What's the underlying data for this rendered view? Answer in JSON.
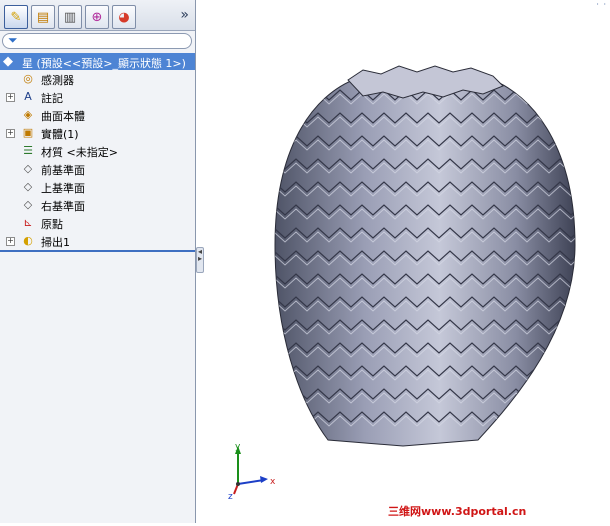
{
  "tabs": [
    {
      "name": "feature-manager",
      "icon": "feature-manager-icon"
    },
    {
      "name": "property-manager",
      "icon": "property-manager-icon"
    },
    {
      "name": "configuration-manager",
      "icon": "configuration-manager-icon"
    },
    {
      "name": "dimxpert-manager",
      "icon": "dimxpert-icon"
    },
    {
      "name": "display-manager",
      "icon": "display-manager-icon"
    }
  ],
  "expand_label": "»",
  "root": {
    "label": "星 (預設<<預設>_顯示狀態 1>)"
  },
  "tree": [
    {
      "label": "感測器",
      "icon": "sensor-icon",
      "expandable": false
    },
    {
      "label": "註記",
      "icon": "annotation-icon",
      "expandable": true
    },
    {
      "label": "曲面本體",
      "icon": "surface-body-icon",
      "expandable": false
    },
    {
      "label": "實體(1)",
      "icon": "solid-body-icon",
      "expandable": true
    },
    {
      "label": "材質 <未指定>",
      "icon": "material-icon",
      "expandable": false
    },
    {
      "label": "前基準面",
      "icon": "plane-icon",
      "expandable": false
    },
    {
      "label": "上基準面",
      "icon": "plane-icon",
      "expandable": false
    },
    {
      "label": "右基準面",
      "icon": "plane-icon",
      "expandable": false
    },
    {
      "label": "原點",
      "icon": "origin-icon",
      "expandable": false
    },
    {
      "label": "掃出1",
      "icon": "sweep-icon",
      "expandable": true
    }
  ],
  "triad": {
    "x": "x",
    "y": "y",
    "z": "z"
  },
  "watermark": "三维网www.3dportal.cn",
  "colors": {
    "selection": "#4d84d4",
    "model": "#8f93a8",
    "watermark": "#d01616"
  }
}
